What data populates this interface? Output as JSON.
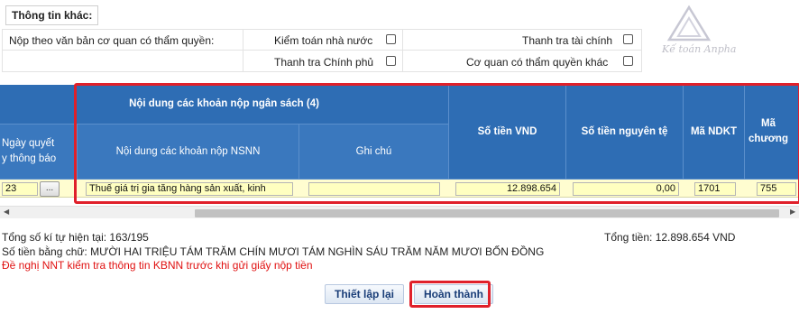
{
  "info_section": {
    "title": "Thông tin khác:",
    "row1": {
      "label": "Nộp theo văn bản cơ quan có thẩm quyền:",
      "opt_kiem_toan": "Kiểm toán nhà nước",
      "opt_thanh_tra_tc": "Thanh tra tài chính"
    },
    "row2": {
      "opt_thanh_tra_cp": "Thanh tra Chính phủ",
      "opt_co_quan_khac": "Cơ quan có thẩm quyền khác"
    },
    "watermark_text": "Kế toán Anpha"
  },
  "grid": {
    "group_header": "Nội dung các khoản nộp ngân sách (4)",
    "columns": {
      "ngay_quyet": "Ngày quyết\ny thông báo",
      "noi_dung": "Nội dung các khoản nộp NSNN",
      "ghi_chu": "Ghi chú",
      "so_tien_vnd": "Số tiền VND",
      "so_tien_nt": "Số tiền nguyên tệ",
      "ma_ndkt": "Mã NDKT",
      "ma_chuong": "Mã\nchương"
    },
    "row": {
      "ngay": "23",
      "ngay_btn": "...",
      "noi_dung": "Thuế giá trị gia tăng hàng sản xuất, kinh",
      "ghi_chu": "",
      "so_tien_vnd": "12.898.654",
      "so_tien_nt": "0,00",
      "ma_ndkt": "1701",
      "ma_chuong": "755"
    }
  },
  "footer": {
    "char_count": "Tổng số kí tự hiện tại: 163/195",
    "total": "Tổng tiền: 12.898.654 VND",
    "amount_words": "Số tiền bằng chữ: MƯỜI HAI TRIỆU TÁM TRĂM CHÍN MƯƠI TÁM NGHÌN SÁU TRĂM NĂM MƯƠI BỐN ĐỒNG",
    "warning": "Đề nghị NNT kiểm tra thông tin KBNN trước khi gửi giấy nộp tiền"
  },
  "buttons": {
    "reset": "Thiết lập lại",
    "finish": "Hoàn thành"
  },
  "colors": {
    "header_blue": "#2e6db4",
    "highlight_red": "#e0202a",
    "row_yellow": "#fffdd0",
    "warning_red": "#e01010"
  }
}
